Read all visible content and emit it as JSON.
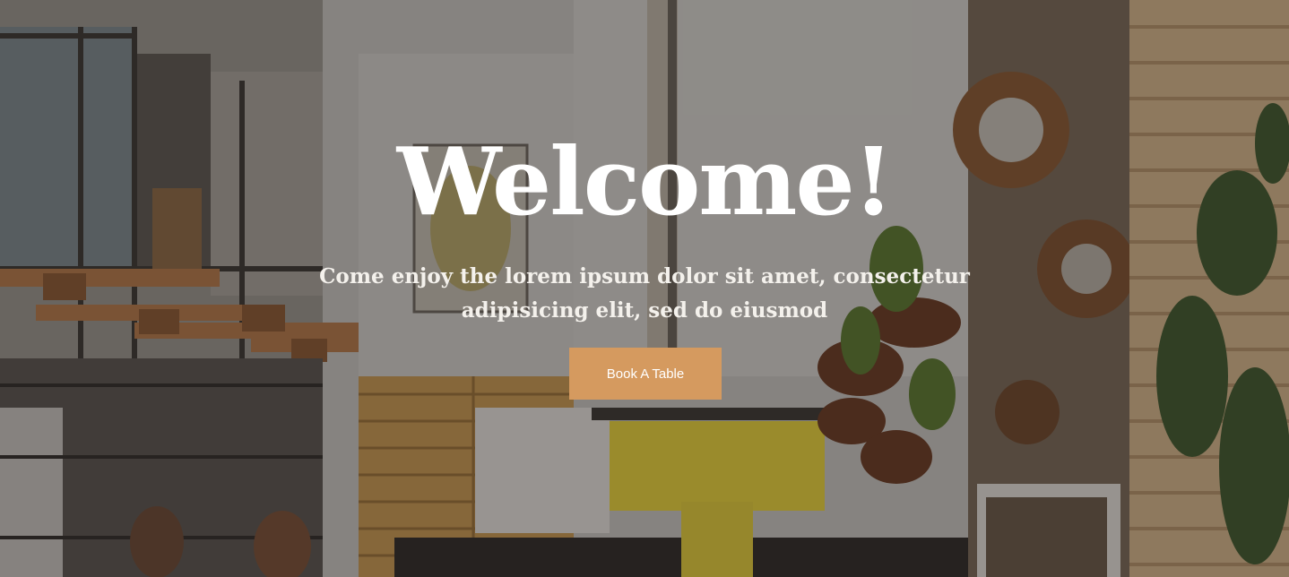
{
  "hero": {
    "title": "Welcome!",
    "subtitle": "Come enjoy the lorem ipsum dolor sit amet, consectetur adipisicing elit, sed do eiusmod",
    "cta_label": "Book A Table",
    "background": "cafe-interior-photo"
  },
  "colors": {
    "accent": "#d59a5f",
    "title_text": "#ffffff",
    "overlay": "rgba(25,22,20,0.38)"
  }
}
